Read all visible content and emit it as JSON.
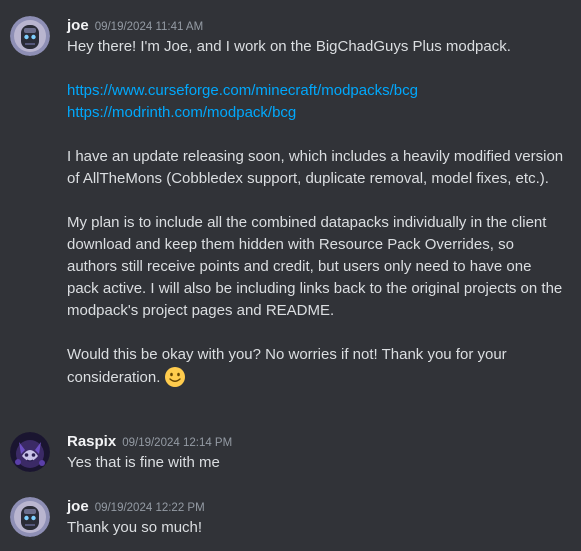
{
  "messages": [
    {
      "author": "joe",
      "timestamp": "09/19/2024 11:41 AM",
      "avatar_icon": "robot-avatar-icon",
      "intro": "Hey there! I'm Joe, and I work on the BigChadGuys Plus modpack.",
      "links": [
        "https://www.curseforge.com/minecraft/modpacks/bcg",
        "https://modrinth.com/modpack/bcg"
      ],
      "paragraph_1": "I have an update releasing soon, which includes a heavily modified version of AllTheMons (Cobbledex support, duplicate removal, model fixes, etc.).",
      "paragraph_2": "My plan is to include all the combined datapacks individually in the client download and keep them hidden with Resource Pack Overrides, so authors still receive points and credit, but users only need to have one pack active. I will also be including links back to the original projects on the modpack's project pages and README.",
      "paragraph_3": "Would this be okay with you? No worries if not! Thank you for your consideration.",
      "emoji": "slightly-smiling-face-emoji"
    },
    {
      "author": "Raspix",
      "timestamp": "09/19/2024 12:14 PM",
      "avatar_icon": "wolf-avatar-icon",
      "text": "Yes that is fine with me"
    },
    {
      "author": "joe",
      "timestamp": "09/19/2024 12:22 PM",
      "avatar_icon": "robot-avatar-icon",
      "text": "Thank you so much!"
    }
  ],
  "colors": {
    "background": "#313338",
    "text": "#dbdee1",
    "author": "#f2f3f5",
    "timestamp": "#949ba4",
    "link": "#00a8fc"
  }
}
